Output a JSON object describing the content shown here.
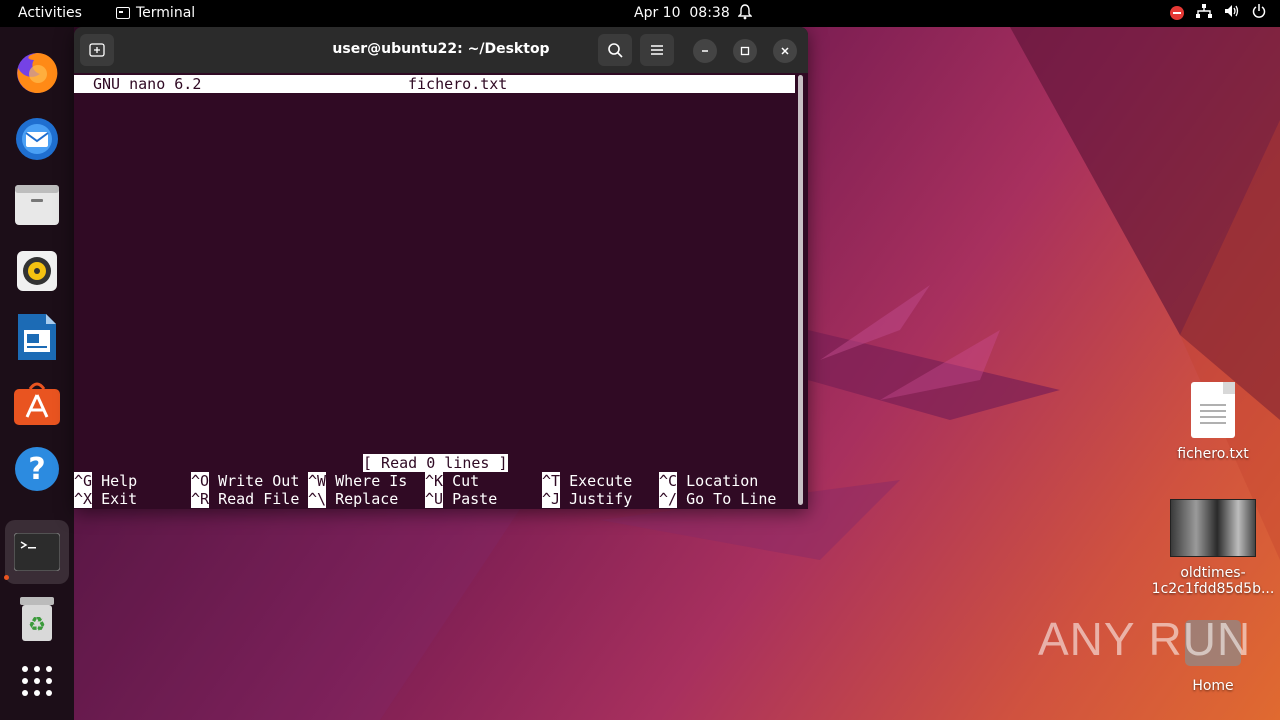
{
  "topbar": {
    "activities": "Activities",
    "app_name": "Terminal",
    "clock": "Apr 10  08:38",
    "bell_icon": "bell-icon"
  },
  "dock": {
    "items": [
      "firefox",
      "thunderbird",
      "files",
      "rhythmbox",
      "libreoffice-writer",
      "ubuntu-software",
      "help",
      "terminal",
      "trash",
      "show-apps"
    ]
  },
  "terminal": {
    "title": "user@ubuntu22: ~/Desktop",
    "nano_version": "GNU nano 6.2",
    "filename": "fichero.txt",
    "status_message": "[ Read 0 lines ]",
    "shortcuts": [
      {
        "key": "^G",
        "label": "Help"
      },
      {
        "key": "^O",
        "label": "Write Out"
      },
      {
        "key": "^W",
        "label": "Where Is"
      },
      {
        "key": "^K",
        "label": "Cut"
      },
      {
        "key": "^T",
        "label": "Execute"
      },
      {
        "key": "^C",
        "label": "Location"
      },
      {
        "key": "^X",
        "label": "Exit"
      },
      {
        "key": "^R",
        "label": "Read File"
      },
      {
        "key": "^\\",
        "label": "Replace"
      },
      {
        "key": "^U",
        "label": "Paste"
      },
      {
        "key": "^J",
        "label": "Justify"
      },
      {
        "key": "^/",
        "label": "Go To Line"
      }
    ]
  },
  "desktop": {
    "file1": "fichero.txt",
    "file2_line1": "oldtimes-",
    "file2_line2": "1c2c1fdd85d5b...",
    "home": "Home"
  },
  "watermark": "ANY RUN"
}
